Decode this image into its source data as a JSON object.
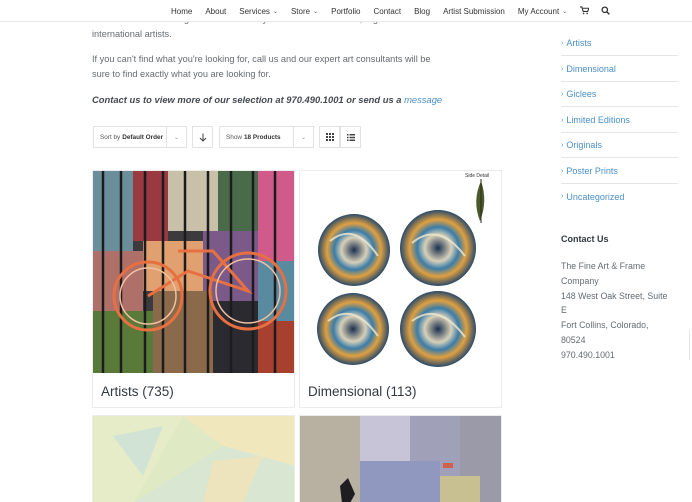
{
  "nav": {
    "items": [
      {
        "label": "Home",
        "chevron": false
      },
      {
        "label": "About",
        "chevron": false
      },
      {
        "label": "Services",
        "chevron": true
      },
      {
        "label": "Store",
        "chevron": true
      },
      {
        "label": "Portfolio",
        "chevron": false
      },
      {
        "label": "Contact",
        "chevron": false
      },
      {
        "label": "Blog",
        "chevron": false
      },
      {
        "label": "Artist Submission",
        "chevron": false
      },
      {
        "label": "My Account",
        "chevron": true
      }
    ],
    "cart_icon": "cart-icon",
    "search_icon": "search-icon"
  },
  "intro": {
    "line0": "database contains images in a wide variety of mediums from local, regional and",
    "line1": "international artists.",
    "line2": "If you can't find what you're looking for, call us and our expert art consultants will be",
    "line3": "sure to find exactly what you are looking for.",
    "contact_text": "Contact us to view more of our selection at 970.490.1001 or send us a ",
    "contact_link": "message"
  },
  "toolbar": {
    "sort_prefix": "Sort by",
    "sort_value": "Default Order",
    "show_prefix": "Show",
    "show_value": "18 Products",
    "sort_direction_icon": "arrow-down-icon",
    "grid_view_icon": "grid-icon",
    "list_view_icon": "list-icon"
  },
  "products": [
    {
      "title": "Artists (735)"
    },
    {
      "title": "Dimensional (113)",
      "image_caption": "Side Detail"
    },
    {
      "title": ""
    },
    {
      "title": ""
    }
  ],
  "sidebar": {
    "categories": [
      "Artists",
      "Dimensional",
      "Giclees",
      "Limited Editions",
      "Originals",
      "Poster Prints",
      "Uncategorized"
    ],
    "contact_heading": "Contact Us",
    "address": {
      "line0": "The Fine Art & Frame",
      "line1": "Company",
      "line2": "148 West Oak Street, Suite",
      "line3": "E",
      "line4": "Fort Collins, Colorado,",
      "line5": "80524",
      "line6": "970.490.1001"
    }
  },
  "colors": {
    "link": "#4a8fc7",
    "text": "#666b71",
    "heading": "#333940"
  }
}
